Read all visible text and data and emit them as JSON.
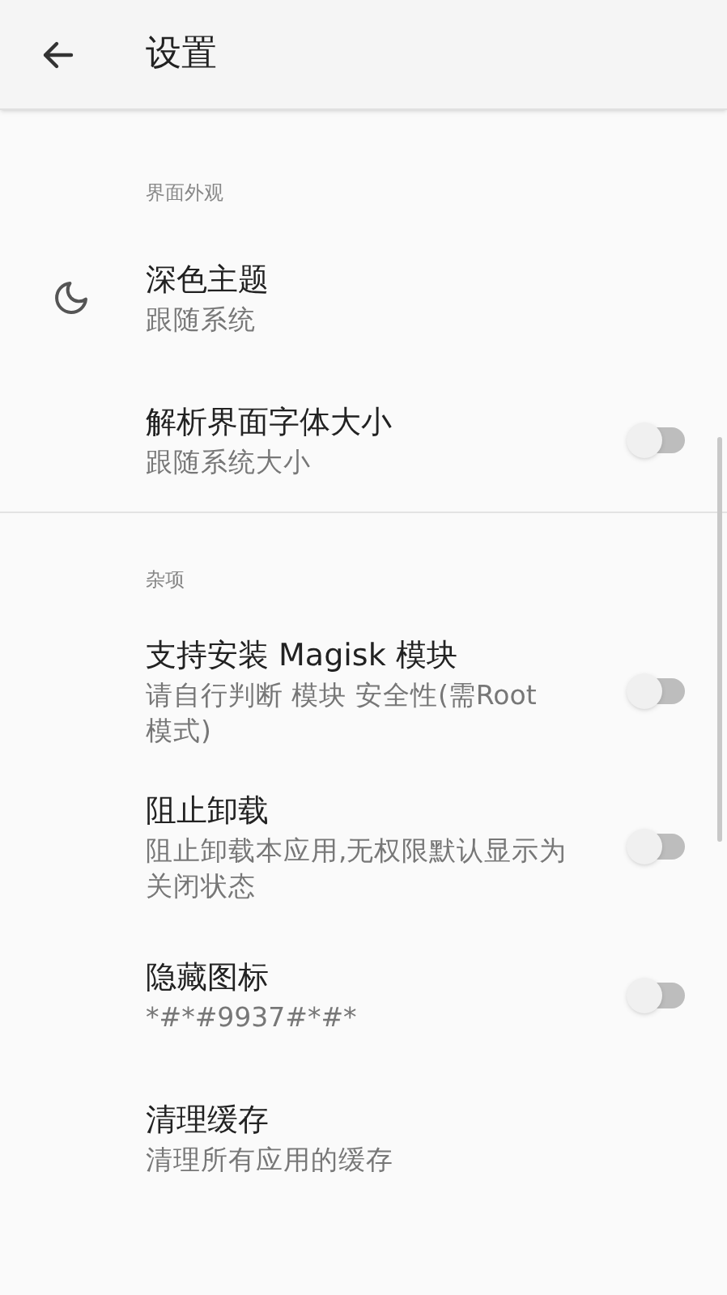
{
  "app_bar": {
    "title": "设置"
  },
  "sections": [
    {
      "header": "界面外观",
      "items": [
        {
          "kind": "icon",
          "title": "深色主题",
          "subtitle": "跟随系统"
        },
        {
          "kind": "switch",
          "title": "解析界面字体大小",
          "subtitle": "跟随系统大小",
          "on": false
        }
      ]
    },
    {
      "header": "杂项",
      "items": [
        {
          "kind": "switch",
          "title": "支持安装 Magisk 模块",
          "subtitle": "请自行判断 模块 安全性(需Root 模式)",
          "on": false
        },
        {
          "kind": "switch",
          "title": "阻止卸载",
          "subtitle": "阻止卸载本应用,无权限默认显示为关闭状态",
          "on": false
        },
        {
          "kind": "switch",
          "title": "隐藏图标",
          "subtitle": "*#*#9937#*#*",
          "on": false
        },
        {
          "kind": "text",
          "title": "清理缓存",
          "subtitle": "清理所有应用的缓存"
        }
      ]
    }
  ]
}
